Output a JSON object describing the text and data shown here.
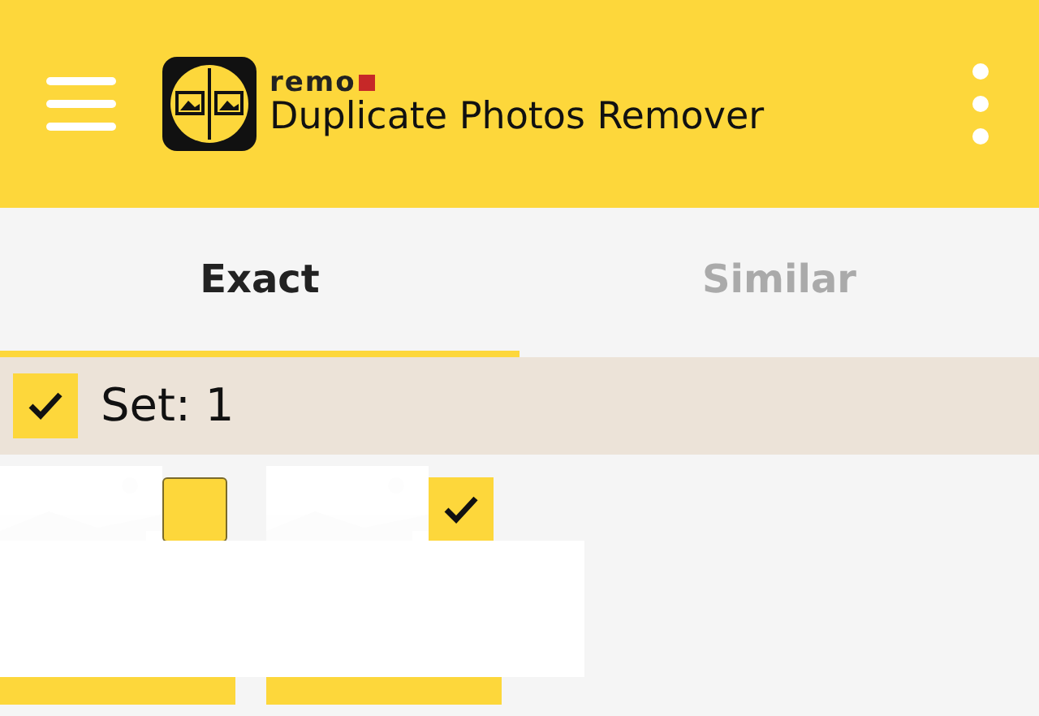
{
  "app_bar": {
    "brand": "remo",
    "title": "Duplicate Photos Remover"
  },
  "tabs": [
    {
      "label": "Exact",
      "selected": true
    },
    {
      "label": "Similar",
      "selected": false
    }
  ],
  "set_header": {
    "label": "Set: 1",
    "checked": true
  },
  "photos": [
    {
      "kind": "picture",
      "checked": false
    },
    {
      "kind": "picture",
      "checked": true
    }
  ]
}
